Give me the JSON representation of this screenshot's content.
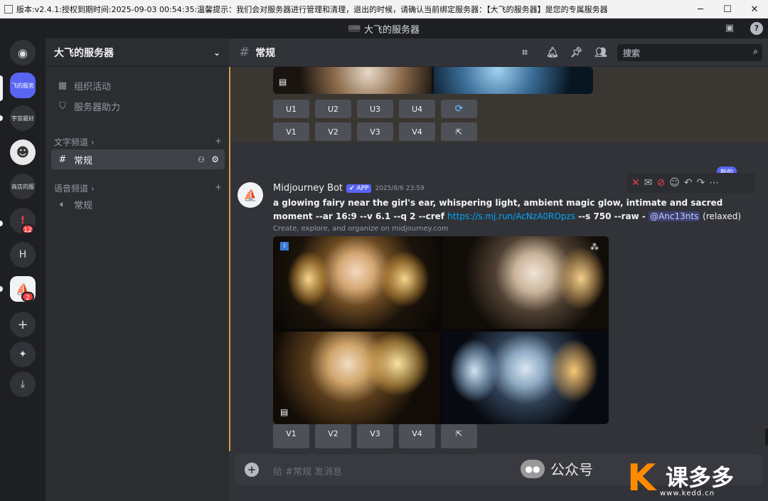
{
  "window": {
    "title": "版本:v2.4.1:授权到期时间:2025-09-03 00:54:35:温馨提示：我们会对服务器进行管理和清理，退出的时候，请确认当前绑定服务器：【大飞的服务器】是您的专属服务器",
    "controls": [
      "─",
      "☐",
      "✕"
    ]
  },
  "topbar": {
    "server_icon_text": "CODE",
    "title": "大飞的服务器",
    "inbox_icon": "inbox-icon",
    "help_icon": "?"
  },
  "guilds": {
    "home_icon": "discord-icon",
    "items": [
      {
        "label": "飞的服务"
      },
      {
        "label": "宇宙最好"
      },
      {
        "label": "☻"
      },
      {
        "label": "商店的服"
      },
      {
        "label": "!",
        "badge": "12"
      },
      {
        "label": "H"
      },
      {
        "label": "⛵",
        "badge": "2"
      },
      {
        "label": "+"
      },
      {
        "label": "✦"
      },
      {
        "label": "⤓"
      }
    ]
  },
  "sidebar": {
    "server_name": "大飞的服务器",
    "items": [
      {
        "label": "组织活动",
        "icon": "📅"
      },
      {
        "label": "服务器助力",
        "icon": "⛉"
      }
    ],
    "text_category": "文字频道",
    "text_channel": "常规",
    "voice_category": "语音频道",
    "voice_channel": "常规",
    "channel_icons": [
      "👥",
      "⚙"
    ]
  },
  "channel": {
    "name": "常规",
    "search_placeholder": "搜索",
    "composer_placeholder": "给 #常规 发消息"
  },
  "buttons": {
    "u": [
      "U1",
      "U2",
      "U3",
      "U4"
    ],
    "v": [
      "V1",
      "V2",
      "V3",
      "V4"
    ],
    "reroll": "⟳",
    "open": "⇱"
  },
  "message": {
    "author": "Midjourney Bot",
    "app_tag": "✔ APP",
    "timestamp": "2025/8/6 23:59",
    "prompt_text": "a glowing fairy near the girl's ear, whispering light, ambient magic glow, intimate and sacred moment --ar 16:9 --v 6.1 --q 2 --cref ",
    "link": "https://s.mj.run/AcNzA0ROpzs",
    "prompt_tail": " --s 750 --raw - ",
    "mention": "@Anc13nts",
    "mode": " (relaxed)",
    "subtitle": "Create, explore, and organize on midjourney.com",
    "new_tag": "新的"
  },
  "watermark": {
    "wechat": "公众号",
    "brand": "课多多",
    "url": "www.kedd.cn"
  }
}
